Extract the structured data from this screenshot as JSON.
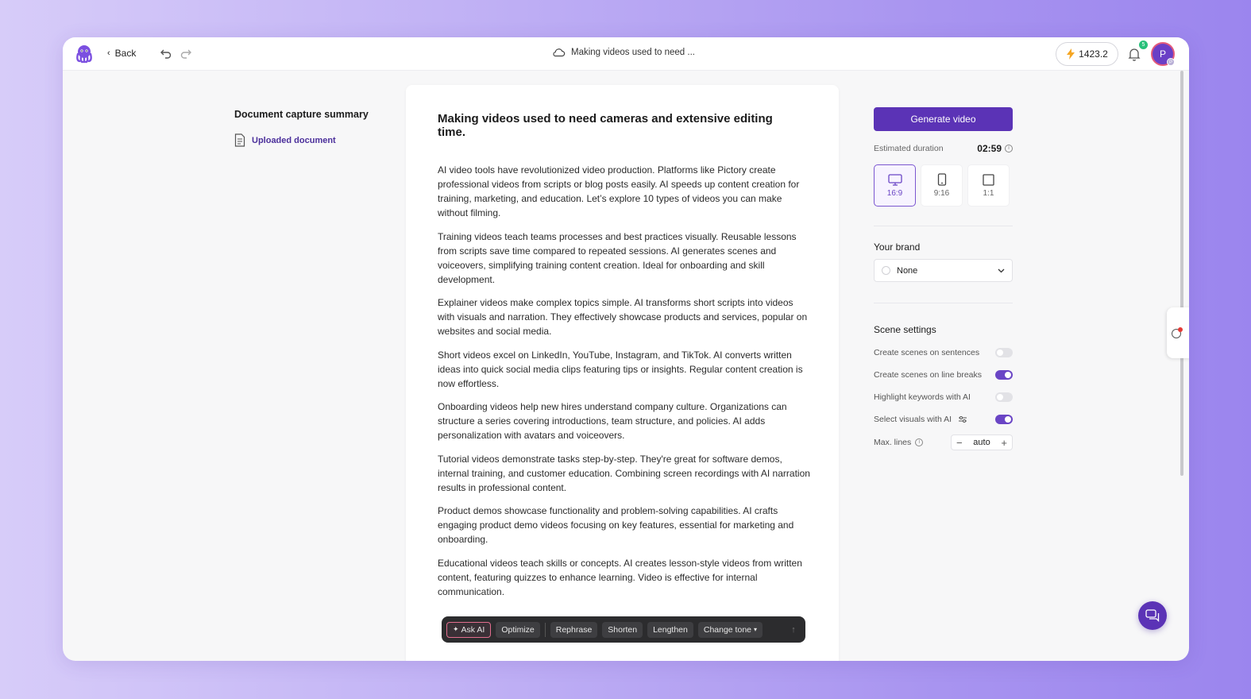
{
  "topbar": {
    "back_label": "Back",
    "doc_title": "Making videos used to need ...",
    "credits": "1423.2",
    "notification_count": "5",
    "avatar_initial": "P",
    "avatar_mini": "P"
  },
  "left_panel": {
    "heading": "Document capture summary",
    "item_label": "Uploaded document"
  },
  "editor": {
    "title": "Making videos used to need cameras and extensive editing time.",
    "paragraphs": [
      "AI video tools have revolutionized video production. Platforms like Pictory create professional videos from scripts or blog posts easily. AI speeds up content creation for training, marketing, and education. Let’s explore 10 types of videos you can make without filming.",
      "Training videos teach teams processes and best practices visually. Reusable lessons from scripts save time compared to repeated sessions. AI generates scenes and voiceovers, simplifying training content creation. Ideal for onboarding and skill development.",
      "Explainer videos make complex topics simple. AI transforms short scripts into videos with visuals and narration. They effectively showcase products and services, popular on websites and social media.",
      "Short videos excel on LinkedIn, YouTube, Instagram, and TikTok. AI converts written ideas into quick social media clips featuring tips or insights. Regular content creation is now effortless.",
      "Onboarding videos help new hires understand company culture. Organizations can structure a series covering introductions, team structure, and policies. AI adds personalization with avatars and voiceovers.",
      "Tutorial videos demonstrate tasks step-by-step. They're great for software demos, internal training, and customer education. Combining screen recordings with AI narration results in professional content.",
      "Product demos showcase functionality and problem-solving capabilities. AI crafts engaging product demo videos focusing on key features, essential for marketing and onboarding.",
      "Educational videos teach skills or concepts. AI creates lesson-style videos from written content, featuring quizzes to enhance learning. Video is effective for internal communication."
    ]
  },
  "ai_toolbar": {
    "ask_ai": "Ask AI",
    "optimize": "Optimize",
    "rephrase": "Rephrase",
    "shorten": "Shorten",
    "lengthen": "Lengthen",
    "change_tone": "Change tone"
  },
  "right_panel": {
    "generate_label": "Generate video",
    "duration_label": "Estimated duration",
    "duration_value": "02:59",
    "ratios": [
      {
        "label": "16:9",
        "active": true
      },
      {
        "label": "9:16",
        "active": false
      },
      {
        "label": "1:1",
        "active": false
      }
    ],
    "brand_label": "Your brand",
    "brand_value": "None",
    "scene_label": "Scene settings",
    "toggles": [
      {
        "label": "Create scenes on sentences",
        "on": false
      },
      {
        "label": "Create scenes on line breaks",
        "on": true
      },
      {
        "label": "Highlight keywords with AI",
        "on": false
      },
      {
        "label": "Select visuals with AI",
        "on": true
      }
    ],
    "max_lines_label": "Max. lines",
    "max_lines_value": "auto"
  },
  "colors": {
    "accent": "#5b33b6",
    "toggle_on": "#6a45c5",
    "badge": "#27c07a"
  },
  "icons": [
    "octopus-logo-icon",
    "chevron-left-icon",
    "undo-icon",
    "redo-icon",
    "cloud-icon",
    "lightning-icon",
    "bell-icon",
    "document-icon",
    "sparkle-icon",
    "monitor-icon",
    "phone-icon",
    "square-icon",
    "chevron-down-icon",
    "sliders-icon",
    "info-icon",
    "minus-icon",
    "plus-icon",
    "chat-icon"
  ]
}
